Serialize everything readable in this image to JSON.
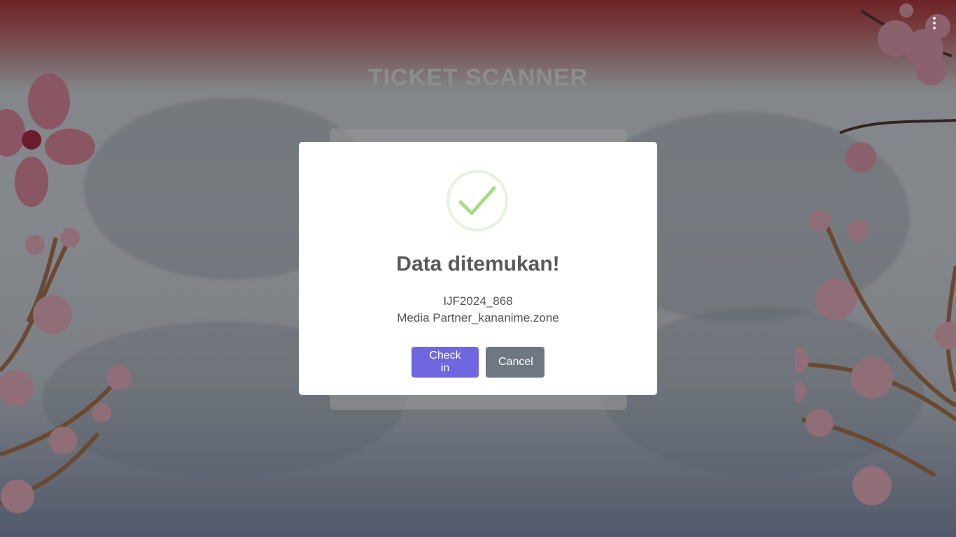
{
  "page": {
    "title": "TICKET SCANNER"
  },
  "modal": {
    "icon": "checkmark-success-icon",
    "title": "Data ditemukan!",
    "ticket_code": "IJF2024_868",
    "ticket_holder": "Media Partner_kananime.zone",
    "confirm_label": "Check in",
    "cancel_label": "Cancel"
  },
  "colors": {
    "confirm": "#7066e0",
    "cancel": "#6e7881",
    "success": "#a5dc86"
  }
}
